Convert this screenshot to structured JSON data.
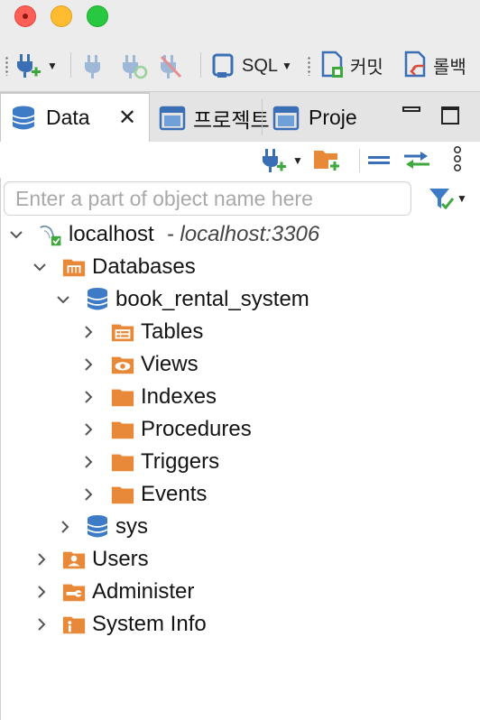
{
  "toolbar": {
    "sql_label": "SQL",
    "commit_label": "커밋",
    "rollback_label": "롤백"
  },
  "tabs": [
    {
      "label": "Data",
      "icon": "database-icon",
      "active": true
    },
    {
      "label": "프로젝ト",
      "icon": "window-icon",
      "active": false
    },
    {
      "label": "Proje",
      "icon": "window-icon",
      "active": false
    }
  ],
  "search": {
    "placeholder": "Enter a part of object name here"
  },
  "tree": {
    "connection": {
      "label": "localhost",
      "detail": "- localhost:3306"
    },
    "databases_label": "Databases",
    "schema": "book_rental_system",
    "schema_children": [
      "Tables",
      "Views",
      "Indexes",
      "Procedures",
      "Triggers",
      "Events"
    ],
    "sys_label": "sys",
    "users_label": "Users",
    "administer_label": "Administer",
    "system_info_label": "System Info"
  },
  "colors": {
    "folder": "#e8893a",
    "db_blue": "#3d7bc7",
    "plug_blue": "#3a6fb5",
    "green_plus": "#3ea83e"
  }
}
